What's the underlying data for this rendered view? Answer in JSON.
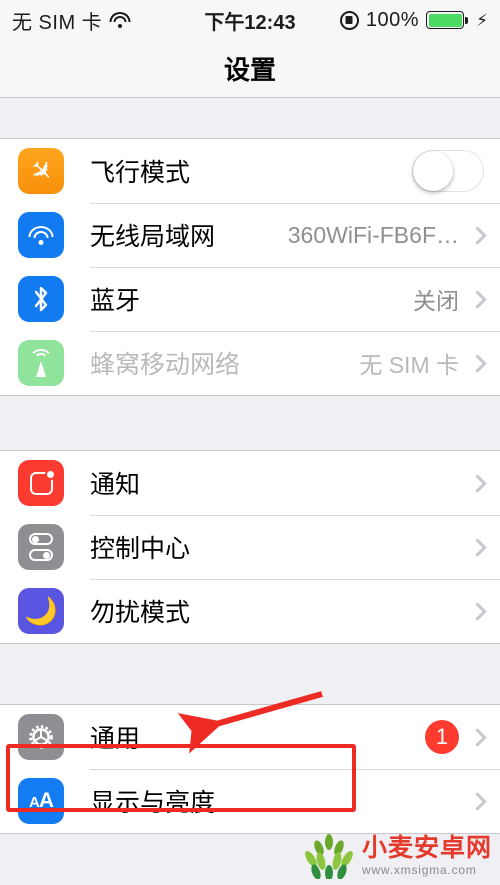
{
  "statusbar": {
    "carrier": "无 SIM 卡",
    "wifi_icon": "wifi-icon",
    "time": "下午12:43",
    "rotation_lock_icon": "rotation-lock-icon",
    "battery_percent": "100%",
    "charging_icon": "lightning-bolt-icon"
  },
  "navbar": {
    "title": "设置"
  },
  "groups": [
    {
      "rows": [
        {
          "label": "飞行模式",
          "icon": "airplane-icon",
          "control": "toggle",
          "toggle_on": false
        },
        {
          "label": "无线局域网",
          "icon": "wifi-icon",
          "value": "360WiFi-FB6F…",
          "control": "chevron"
        },
        {
          "label": "蓝牙",
          "icon": "bluetooth-icon",
          "value": "关闭",
          "control": "chevron"
        },
        {
          "label": "蜂窝移动网络",
          "icon": "cellular-icon",
          "value": "无 SIM 卡",
          "control": "chevron",
          "disabled": true
        }
      ]
    },
    {
      "rows": [
        {
          "label": "通知",
          "icon": "notifications-icon",
          "control": "chevron"
        },
        {
          "label": "控制中心",
          "icon": "control-center-icon",
          "control": "chevron"
        },
        {
          "label": "勿扰模式",
          "icon": "do-not-disturb-icon",
          "control": "chevron"
        }
      ]
    },
    {
      "rows": [
        {
          "label": "通用",
          "icon": "gear-icon",
          "badge": "1",
          "control": "chevron",
          "highlighted": true
        },
        {
          "label": "显示与亮度",
          "icon": "display-brightness-icon",
          "control": "chevron"
        }
      ]
    }
  ],
  "annotation": {
    "color": "#ee2a24",
    "highlight_target": "通用",
    "arrow": "red-arrow-pointing-to-general-row"
  },
  "watermark": {
    "name": "小麦安卓网",
    "url": "www.xmsigma.com",
    "logo": "wheat-logo"
  }
}
